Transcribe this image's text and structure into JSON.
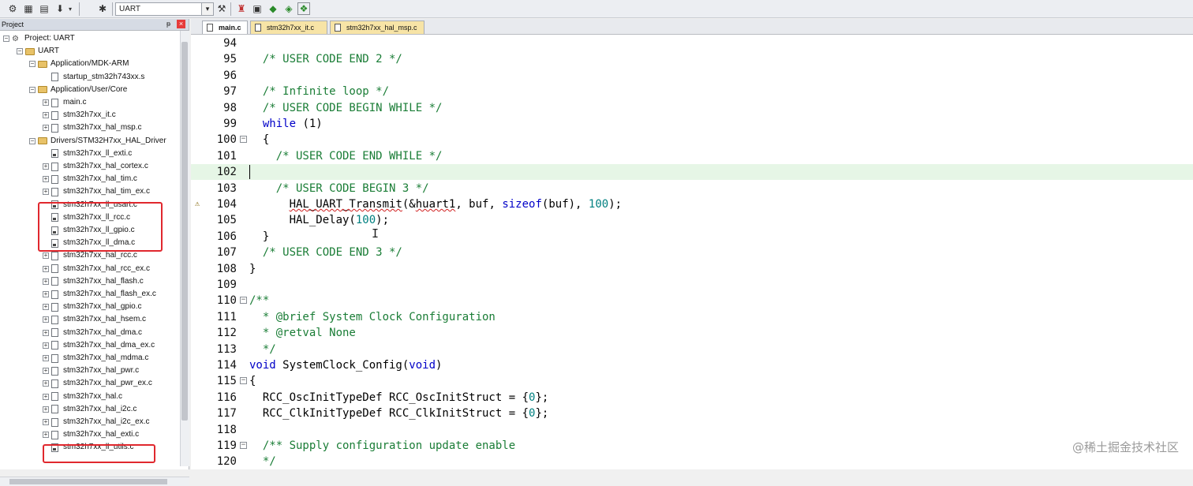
{
  "toolbar": {
    "target": "UART",
    "icons": [
      "build-icon",
      "rebuild-icon",
      "batch-build-icon",
      "download-icon",
      "dropdown-icon",
      "options-icon",
      "manage-project-icon",
      "file-extensions-icon",
      "select-pack-icon",
      "pack-installer-icon",
      "runtime-env-icon",
      "green-diamond-icon",
      "event-recorder-icon"
    ]
  },
  "project_panel": {
    "title": "Project",
    "tree": [
      {
        "label": "Project: UART",
        "level": 0,
        "kind": "project",
        "expander": "−"
      },
      {
        "label": "UART",
        "level": 1,
        "kind": "folder",
        "expander": "−"
      },
      {
        "label": "Application/MDK-ARM",
        "level": 2,
        "kind": "folder",
        "expander": "−"
      },
      {
        "label": "startup_stm32h743xx.s",
        "level": 3,
        "kind": "file",
        "expander": ""
      },
      {
        "label": "Application/User/Core",
        "level": 2,
        "kind": "folder",
        "expander": "−"
      },
      {
        "label": "main.c",
        "level": 3,
        "kind": "file",
        "expander": "+"
      },
      {
        "label": "stm32h7xx_it.c",
        "level": 3,
        "kind": "file",
        "expander": "+"
      },
      {
        "label": "stm32h7xx_hal_msp.c",
        "level": 3,
        "kind": "file",
        "expander": "+"
      },
      {
        "label": "Drivers/STM32H7xx_HAL_Driver",
        "level": 2,
        "kind": "folder",
        "expander": "−"
      },
      {
        "label": "stm32h7xx_ll_exti.c",
        "level": 3,
        "kind": "lib",
        "expander": ""
      },
      {
        "label": "stm32h7xx_hal_cortex.c",
        "level": 3,
        "kind": "file",
        "expander": "+"
      },
      {
        "label": "stm32h7xx_hal_tim.c",
        "level": 3,
        "kind": "file",
        "expander": "+"
      },
      {
        "label": "stm32h7xx_hal_tim_ex.c",
        "level": 3,
        "kind": "file",
        "expander": "+"
      },
      {
        "label": "stm32h7xx_ll_usart.c",
        "level": 3,
        "kind": "lib",
        "expander": ""
      },
      {
        "label": "stm32h7xx_ll_rcc.c",
        "level": 3,
        "kind": "lib",
        "expander": ""
      },
      {
        "label": "stm32h7xx_ll_gpio.c",
        "level": 3,
        "kind": "lib",
        "expander": ""
      },
      {
        "label": "stm32h7xx_ll_dma.c",
        "level": 3,
        "kind": "lib",
        "expander": ""
      },
      {
        "label": "stm32h7xx_hal_rcc.c",
        "level": 3,
        "kind": "file",
        "expander": "+"
      },
      {
        "label": "stm32h7xx_hal_rcc_ex.c",
        "level": 3,
        "kind": "file",
        "expander": "+"
      },
      {
        "label": "stm32h7xx_hal_flash.c",
        "level": 3,
        "kind": "file",
        "expander": "+"
      },
      {
        "label": "stm32h7xx_hal_flash_ex.c",
        "level": 3,
        "kind": "file",
        "expander": "+"
      },
      {
        "label": "stm32h7xx_hal_gpio.c",
        "level": 3,
        "kind": "file",
        "expander": "+"
      },
      {
        "label": "stm32h7xx_hal_hsem.c",
        "level": 3,
        "kind": "file",
        "expander": "+"
      },
      {
        "label": "stm32h7xx_hal_dma.c",
        "level": 3,
        "kind": "file",
        "expander": "+"
      },
      {
        "label": "stm32h7xx_hal_dma_ex.c",
        "level": 3,
        "kind": "file",
        "expander": "+"
      },
      {
        "label": "stm32h7xx_hal_mdma.c",
        "level": 3,
        "kind": "file",
        "expander": "+"
      },
      {
        "label": "stm32h7xx_hal_pwr.c",
        "level": 3,
        "kind": "file",
        "expander": "+"
      },
      {
        "label": "stm32h7xx_hal_pwr_ex.c",
        "level": 3,
        "kind": "file",
        "expander": "+"
      },
      {
        "label": "stm32h7xx_hal.c",
        "level": 3,
        "kind": "file",
        "expander": "+"
      },
      {
        "label": "stm32h7xx_hal_i2c.c",
        "level": 3,
        "kind": "file",
        "expander": "+"
      },
      {
        "label": "stm32h7xx_hal_i2c_ex.c",
        "level": 3,
        "kind": "file",
        "expander": "+"
      },
      {
        "label": "stm32h7xx_hal_exti.c",
        "level": 3,
        "kind": "file",
        "expander": "+"
      },
      {
        "label": "stm32h7xx_ll_utils.c",
        "level": 3,
        "kind": "lib",
        "expander": ""
      }
    ]
  },
  "editor": {
    "tabs": [
      {
        "label": "main.c",
        "state": "active"
      },
      {
        "label": "stm32h7xx_it.c",
        "state": "modified"
      },
      {
        "label": "stm32h7xx_hal_msp.c",
        "state": "modified"
      }
    ],
    "lines": [
      {
        "n": "94",
        "fold": "",
        "segs": []
      },
      {
        "n": "95",
        "fold": "",
        "segs": [
          {
            "t": "  "
          },
          {
            "t": "/* USER CODE END 2 */",
            "c": "cm"
          }
        ]
      },
      {
        "n": "96",
        "fold": "",
        "segs": []
      },
      {
        "n": "97",
        "fold": "",
        "segs": [
          {
            "t": "  "
          },
          {
            "t": "/* Infinite loop */",
            "c": "cm"
          }
        ]
      },
      {
        "n": "98",
        "fold": "",
        "segs": [
          {
            "t": "  "
          },
          {
            "t": "/* USER CODE BEGIN WHILE */",
            "c": "cm"
          }
        ]
      },
      {
        "n": "99",
        "fold": "",
        "segs": [
          {
            "t": "  "
          },
          {
            "t": "while",
            "c": "kw"
          },
          {
            "t": " (1)"
          }
        ]
      },
      {
        "n": "100",
        "fold": "−",
        "segs": [
          {
            "t": "  {"
          }
        ]
      },
      {
        "n": "101",
        "fold": "",
        "segs": [
          {
            "t": "    "
          },
          {
            "t": "/* USER CODE END WHILE */",
            "c": "cm"
          }
        ]
      },
      {
        "n": "102",
        "fold": "",
        "segs": [],
        "current": true
      },
      {
        "n": "103",
        "fold": "",
        "segs": [
          {
            "t": "    "
          },
          {
            "t": "/* USER CODE BEGIN 3 */",
            "c": "cm"
          }
        ]
      },
      {
        "n": "104",
        "fold": "",
        "warn": true,
        "segs": [
          {
            "t": "      "
          },
          {
            "t": "HAL_UART_Transmit",
            "c": "sq"
          },
          {
            "t": "(&"
          },
          {
            "t": "huart1",
            "c": "sq"
          },
          {
            "t": ", buf, "
          },
          {
            "t": "sizeof",
            "c": "kw"
          },
          {
            "t": "(buf), "
          },
          {
            "t": "100",
            "c": "nm"
          },
          {
            "t": ");"
          }
        ]
      },
      {
        "n": "105",
        "fold": "",
        "segs": [
          {
            "t": "      HAL_Delay("
          },
          {
            "t": "100",
            "c": "nm"
          },
          {
            "t": ");"
          }
        ]
      },
      {
        "n": "106",
        "fold": "",
        "segs": [
          {
            "t": "  }"
          }
        ]
      },
      {
        "n": "107",
        "fold": "",
        "segs": [
          {
            "t": "  "
          },
          {
            "t": "/* USER CODE END 3 */",
            "c": "cm"
          }
        ]
      },
      {
        "n": "108",
        "fold": "",
        "segs": [
          {
            "t": "}"
          }
        ]
      },
      {
        "n": "109",
        "fold": "",
        "segs": []
      },
      {
        "n": "110",
        "fold": "−",
        "segs": [
          {
            "t": "/**",
            "c": "cm"
          }
        ]
      },
      {
        "n": "111",
        "fold": "",
        "segs": [
          {
            "t": "  * @brief System Clock Configuration",
            "c": "cm"
          }
        ]
      },
      {
        "n": "112",
        "fold": "",
        "segs": [
          {
            "t": "  * @retval None",
            "c": "cm"
          }
        ]
      },
      {
        "n": "113",
        "fold": "",
        "segs": [
          {
            "t": "  */",
            "c": "cm"
          }
        ]
      },
      {
        "n": "114",
        "fold": "",
        "segs": [
          {
            "t": "void",
            "c": "kw"
          },
          {
            "t": " SystemClock_Config("
          },
          {
            "t": "void",
            "c": "kw"
          },
          {
            "t": ")"
          }
        ]
      },
      {
        "n": "115",
        "fold": "−",
        "segs": [
          {
            "t": "{"
          }
        ]
      },
      {
        "n": "116",
        "fold": "",
        "segs": [
          {
            "t": "  RCC_OscInitTypeDef RCC_OscInitStruct = {"
          },
          {
            "t": "0",
            "c": "nm"
          },
          {
            "t": "};"
          }
        ]
      },
      {
        "n": "117",
        "fold": "",
        "segs": [
          {
            "t": "  RCC_ClkInitTypeDef RCC_ClkInitStruct = {"
          },
          {
            "t": "0",
            "c": "nm"
          },
          {
            "t": "};"
          }
        ]
      },
      {
        "n": "118",
        "fold": "",
        "segs": []
      },
      {
        "n": "119",
        "fold": "−",
        "segs": [
          {
            "t": "  "
          },
          {
            "t": "/** Supply configuration update enable",
            "c": "cm"
          }
        ]
      },
      {
        "n": "120",
        "fold": "",
        "segs": [
          {
            "t": "  "
          },
          {
            "t": "*/",
            "c": "cm"
          }
        ]
      }
    ]
  },
  "watermark": "@稀土掘金技术社区"
}
